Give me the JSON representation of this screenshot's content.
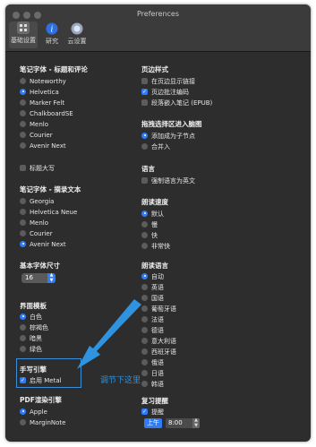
{
  "window": {
    "title": "Preferences"
  },
  "toolbar": {
    "items": [
      {
        "label": "基础设置",
        "icon": "settings-icon",
        "active": true
      },
      {
        "label": "研究",
        "icon": "info-icon",
        "active": false
      },
      {
        "label": "云设置",
        "icon": "cloud-icon",
        "active": false
      }
    ]
  },
  "left": {
    "note_font": {
      "title": "笔记字体 - 标题和评论",
      "options": [
        "Noteworthy",
        "Helvetica",
        "Marker Felt",
        "ChalkboardSE",
        "Menlo",
        "Courier",
        "Avenir Next"
      ],
      "selected": "Helvetica"
    },
    "title_caps": {
      "label": "标题大写",
      "checked": false
    },
    "excerpt_font": {
      "title": "笔记字体 - 摘录文本",
      "options": [
        "Georgia",
        "Helvetica Neue",
        "Menlo",
        "Courier",
        "Avenir Next"
      ],
      "selected": "Avenir Next"
    },
    "font_size": {
      "title": "基本字体尺寸",
      "value": "16"
    },
    "theme": {
      "title": "界面模板",
      "options": [
        "白色",
        "棕褐色",
        "暗黑",
        "绿色"
      ],
      "selected": "白色"
    },
    "handwriting": {
      "title": "手写引擎",
      "label": "启用 Metal",
      "checked": true
    },
    "pdf_render": {
      "title": "PDF渲染引擎",
      "options": [
        "Apple",
        "MarginNote"
      ],
      "selected": "Apple"
    }
  },
  "right": {
    "margin_style": {
      "title": "页边样式",
      "options": [
        {
          "label": "在页边显示链接",
          "checked": false
        },
        {
          "label": "页边批注编码",
          "checked": true
        },
        {
          "label": "段落嵌入笔记 (EPUB)",
          "checked": false
        }
      ]
    },
    "drag_select": {
      "title": "拖拽选择区进入脑图",
      "options": [
        "添加成为子节点",
        "合并入"
      ],
      "selected": "添加成为子节点"
    },
    "language": {
      "title": "语言",
      "label": "强制语言为英文",
      "checked": false
    },
    "read_speed": {
      "title": "朗读速度",
      "options": [
        "默认",
        "慢",
        "快",
        "非常快"
      ],
      "selected": "默认"
    },
    "read_language": {
      "title": "朗读语言",
      "options": [
        "自动",
        "英语",
        "国语",
        "葡萄牙语",
        "法语",
        "德语",
        "意大利语",
        "西班牙语",
        "俄语",
        "日语",
        "韩语"
      ],
      "selected": "自动"
    },
    "review": {
      "title": "复习提醒",
      "label": "提醒",
      "checked": true,
      "ampm": "上午",
      "time": "8:00"
    }
  },
  "annotation": {
    "text": "调节下这里",
    "color": "#2f93e0"
  },
  "colors": {
    "accent": "#2f7cf6",
    "background": "#2d2d2d"
  }
}
